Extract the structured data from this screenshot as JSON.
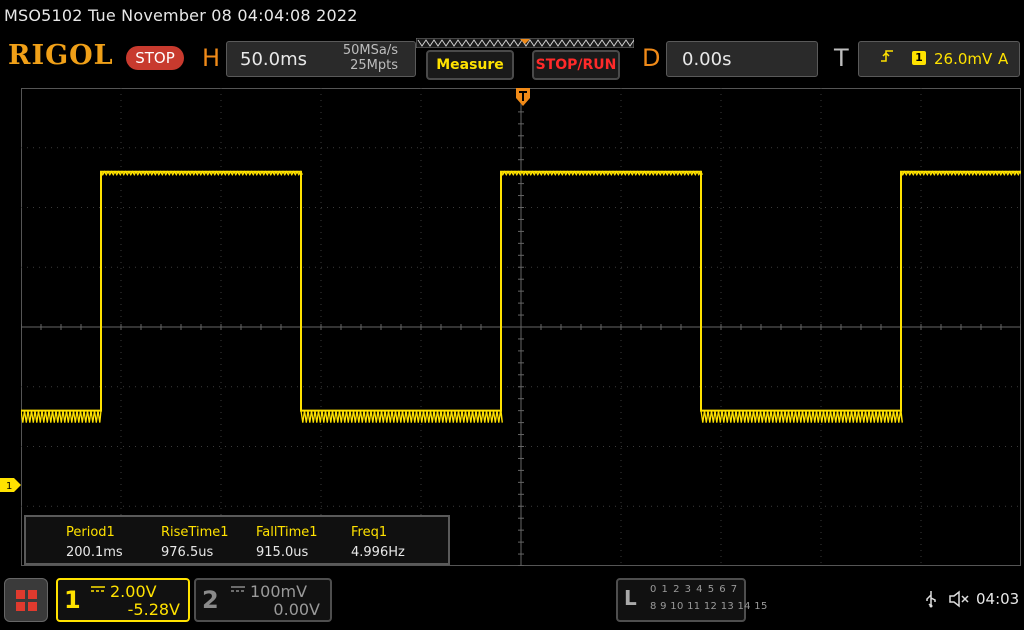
{
  "header": {
    "model_datetime": "MSO5102  Tue November 08 04:04:08 2022",
    "logo": "RIGOL",
    "run_state": "STOP"
  },
  "horizontal": {
    "letter": "H",
    "timebase": "50.0ms",
    "sample_rate": "50MSa/s",
    "memory_depth": "25Mpts"
  },
  "buttons": {
    "measure": "Measure",
    "stop_run": "STOP/RUN"
  },
  "delay": {
    "letter": "D",
    "value": "0.00s"
  },
  "trigger": {
    "letter": "T",
    "slope_icon": "rising-edge-icon",
    "source": "1",
    "level": "26.0mV",
    "mode": "A"
  },
  "measurements": {
    "headers": [
      "Period1",
      "RiseTime1",
      "FallTime1",
      "Freq1"
    ],
    "values": [
      "200.1ms",
      "976.5us",
      "915.0us",
      "4.996Hz"
    ]
  },
  "channels": {
    "ch1": {
      "number": "1",
      "scale": "2.00V",
      "offset": "-5.28V",
      "coupling_icon": "dc-coupling-icon",
      "marker": "1"
    },
    "ch2": {
      "number": "2",
      "scale": "100mV",
      "offset": "0.00V",
      "coupling_icon": "dc-coupling-icon"
    }
  },
  "logic_analyzer": {
    "letter": "L",
    "row1": "0 1 2 3  4 5 6 7",
    "row2": "8 9 10 11 12 13 14 15"
  },
  "status": {
    "time": "04:03",
    "icons": [
      "usb-icon",
      "speaker-muted-icon"
    ]
  },
  "colors": {
    "ch1": "#ffe200",
    "trigger_marker": "#f08a18",
    "stop": "#c83a2e",
    "stop_run_text": "#ff2a2a"
  },
  "chart_data": {
    "type": "line",
    "title": "",
    "xlabel": "",
    "ylabel": "",
    "x_divisions": 10,
    "y_divisions": 8,
    "x_unit_per_div": "50.0ms",
    "y_unit_per_div": "2.00V",
    "grid": true,
    "series": [
      {
        "name": "",
        "waveform": "square",
        "period_ms": 200.1,
        "x_ms": [
          -250,
          -210,
          -210,
          -110,
          -110,
          -10,
          -10,
          90,
          90,
          190,
          190,
          250
        ],
        "y_div": [
          -1.4,
          -1.4,
          2.6,
          2.6,
          -1.4,
          -1.4,
          2.6,
          2.6,
          -1.4,
          -1.4,
          2.6,
          2.6
        ]
      }
    ]
  }
}
